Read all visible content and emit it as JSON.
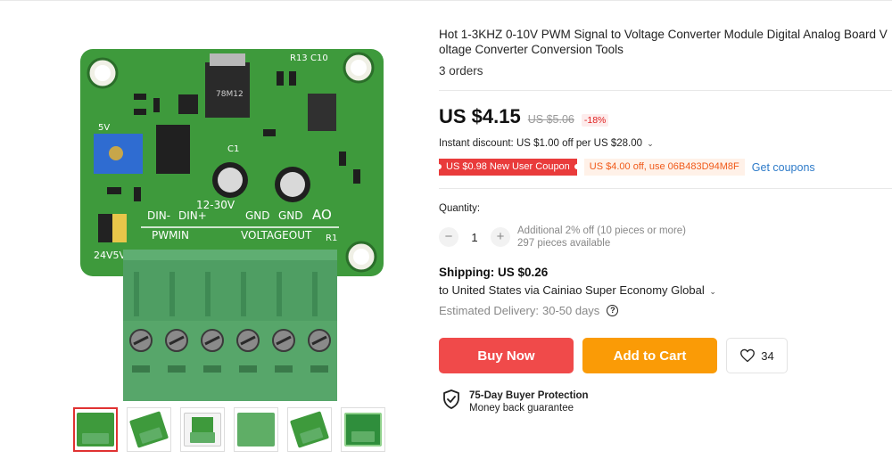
{
  "product": {
    "title": "Hot 1-3KHZ 0-10V PWM Signal to Voltage Converter Module Digital Analog Board Voltage Converter Conversion Tools",
    "orders": "3 orders"
  },
  "price": {
    "current": "US $4.15",
    "original": "US $5.06",
    "discount": "-18%",
    "instant_discount": "Instant discount: US $1.00 off per US $28.00"
  },
  "coupons": {
    "new_user": "US $0.98 New User Coupon",
    "code": "US $4.00 off, use 06B483D94M8F",
    "link": "Get coupons"
  },
  "quantity": {
    "label": "Quantity:",
    "value": "1",
    "minus": "−",
    "plus": "+",
    "note_line1": "Additional 2% off (10 pieces or more)",
    "note_line2": "297 pieces available"
  },
  "shipping": {
    "title": "Shipping: US $0.26",
    "to": "to United States via Cainiao Super Economy Global",
    "estimated_label": "Estimated Delivery:",
    "estimated_value": "30-50 days"
  },
  "actions": {
    "buy_now": "Buy Now",
    "add_to_cart": "Add to Cart",
    "wishlist_count": "34"
  },
  "protection": {
    "title": "75-Day Buyer Protection",
    "subtitle": "Money back guarantee"
  },
  "board": {
    "silk": {
      "din_minus": "DIN-",
      "din_plus": "DIN+",
      "v12_30": "12-30V",
      "gnd1": "GND",
      "gnd2": "GND",
      "ao": "AO",
      "pwmin": "PWMIN",
      "voltageout": "VOLTAGEOUT",
      "v24_5": "24V5V",
      "r13": "R13",
      "c10": "C10",
      "r1": "R1",
      "c1": "C1",
      "v5v": "5V",
      "reg": "78M12"
    }
  },
  "icons": {
    "heart": "heart-icon",
    "shield": "shield-check-icon",
    "help": "question-circle-icon",
    "chevron": "chevron-down-icon"
  },
  "colors": {
    "buy_now": "#f04a4a",
    "add_to_cart": "#fa9b06",
    "coupon_red": "#e93b3b",
    "coupon_orange_text": "#f05a1a",
    "link_blue": "#2e7bc9",
    "pcb_green": "#3e9a3c"
  }
}
